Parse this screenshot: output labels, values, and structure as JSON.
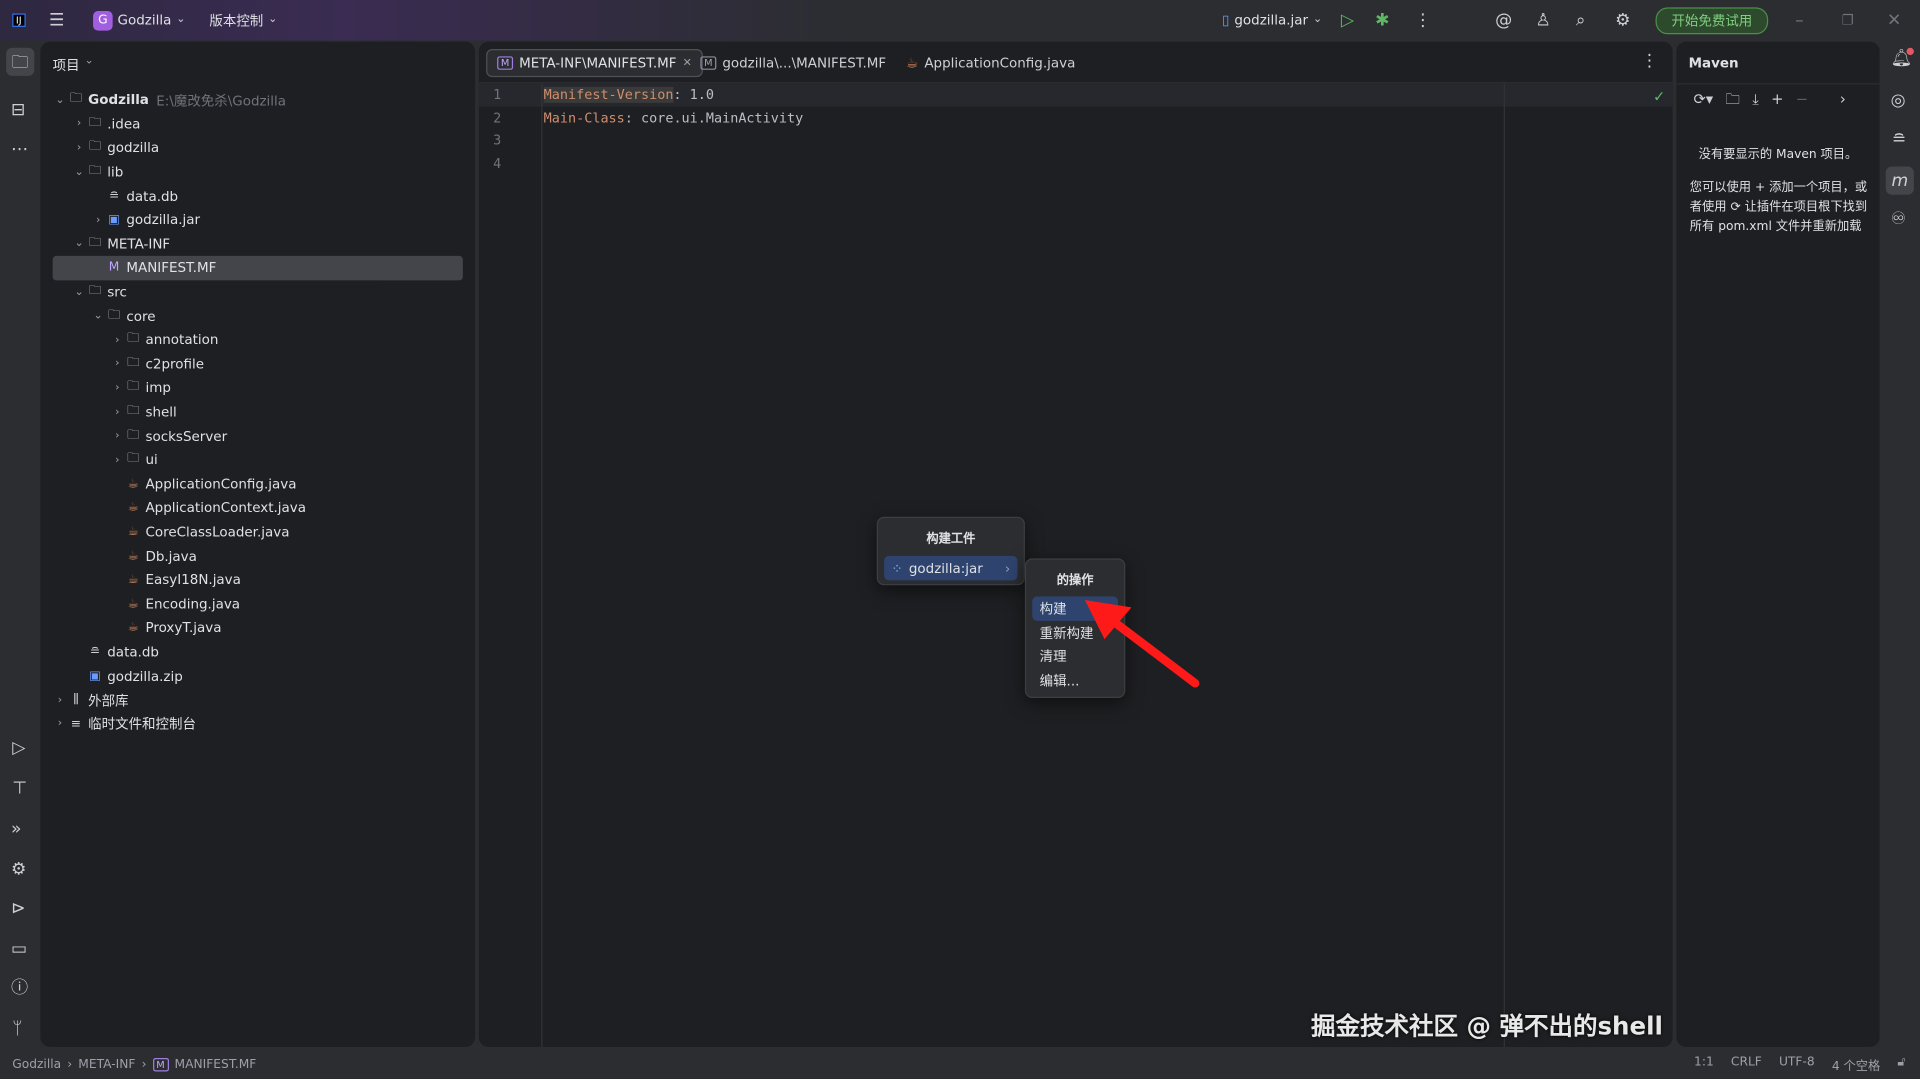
{
  "titlebar": {
    "project_badge": "G",
    "project": "Godzilla",
    "vcs": "版本控制",
    "run_config": "godzilla.jar",
    "trial": "开始免费试用"
  },
  "project_panel": {
    "title": "项目",
    "tree": [
      {
        "label": "Godzilla",
        "hint": "E:\\魔改免杀\\Godzilla",
        "level": 0,
        "chev": "v",
        "icon": "folder-module-icon",
        "bold": true
      },
      {
        "label": ".idea",
        "level": 1,
        "chev": ">",
        "icon": "folder-icon"
      },
      {
        "label": "godzilla",
        "level": 1,
        "chev": ">",
        "icon": "folder-icon"
      },
      {
        "label": "lib",
        "level": 1,
        "chev": "v",
        "icon": "folder-icon"
      },
      {
        "label": "data.db",
        "level": 2,
        "chev": "",
        "icon": "database-icon"
      },
      {
        "label": "godzilla.jar",
        "level": 2,
        "chev": ">",
        "icon": "jar-icon"
      },
      {
        "label": "META-INF",
        "level": 1,
        "chev": "v",
        "icon": "folder-icon"
      },
      {
        "label": "MANIFEST.MF",
        "level": 2,
        "chev": "",
        "icon": "manifest-icon",
        "selected": true
      },
      {
        "label": "src",
        "level": 1,
        "chev": "v",
        "icon": "folder-icon"
      },
      {
        "label": "core",
        "level": 2,
        "chev": "v",
        "icon": "folder-icon"
      },
      {
        "label": "annotation",
        "level": 3,
        "chev": ">",
        "icon": "folder-icon"
      },
      {
        "label": "c2profile",
        "level": 3,
        "chev": ">",
        "icon": "folder-icon"
      },
      {
        "label": "imp",
        "level": 3,
        "chev": ">",
        "icon": "folder-icon"
      },
      {
        "label": "shell",
        "level": 3,
        "chev": ">",
        "icon": "folder-icon"
      },
      {
        "label": "socksServer",
        "level": 3,
        "chev": ">",
        "icon": "folder-icon"
      },
      {
        "label": "ui",
        "level": 3,
        "chev": ">",
        "icon": "folder-icon"
      },
      {
        "label": "ApplicationConfig.java",
        "level": 3,
        "chev": "",
        "icon": "java-icon"
      },
      {
        "label": "ApplicationContext.java",
        "level": 3,
        "chev": "",
        "icon": "java-icon"
      },
      {
        "label": "CoreClassLoader.java",
        "level": 3,
        "chev": "",
        "icon": "java-icon"
      },
      {
        "label": "Db.java",
        "level": 3,
        "chev": "",
        "icon": "java-icon"
      },
      {
        "label": "EasyI18N.java",
        "level": 3,
        "chev": "",
        "icon": "java-icon"
      },
      {
        "label": "Encoding.java",
        "level": 3,
        "chev": "",
        "icon": "java-icon"
      },
      {
        "label": "ProxyT.java",
        "level": 3,
        "chev": "",
        "icon": "java-icon"
      },
      {
        "label": "data.db",
        "level": 1,
        "chev": "",
        "icon": "database-icon"
      },
      {
        "label": "godzilla.zip",
        "level": 1,
        "chev": "",
        "icon": "zip-icon"
      },
      {
        "label": "外部库",
        "level": 0,
        "chev": ">",
        "icon": "library-icon"
      },
      {
        "label": "临时文件和控制台",
        "level": 0,
        "chev": ">",
        "icon": "scratch-icon"
      }
    ]
  },
  "editor": {
    "tabs": [
      {
        "label": "META-INF\\MANIFEST.MF",
        "active": true
      },
      {
        "label": "godzilla\\...\\MANIFEST.MF"
      },
      {
        "label": "ApplicationConfig.java"
      }
    ],
    "lines": [
      {
        "n": "1",
        "key": "Manifest-Version",
        "val": ": 1.0"
      },
      {
        "n": "2",
        "key": "Main-Class",
        "val": ": core.ui.MainActivity"
      },
      {
        "n": "3",
        "key": "",
        "val": ""
      },
      {
        "n": "4",
        "key": "",
        "val": ""
      }
    ]
  },
  "popup": {
    "title": "构建工件",
    "item": "godzilla:jar",
    "sub_title": "的操作",
    "actions": [
      "构建",
      "重新构建",
      "清理",
      "编辑..."
    ]
  },
  "maven": {
    "title": "Maven",
    "empty": "没有要显示的 Maven 项目。",
    "help1": "您可以使用",
    "help2": "添加一个项目，或",
    "help3": "者使用",
    "help4": "让插件在项目根下找到所有 pom.xml 文件并重新加载"
  },
  "watermark": "掘金技术社区 @ 弹不出的shell",
  "status": {
    "crumbs": [
      "Godzilla",
      "META-INF",
      "MANIFEST.MF"
    ],
    "pos": "1:1",
    "eol": "CRLF",
    "enc": "UTF-8",
    "indent": "4 个空格"
  },
  "colors": {
    "accent": "#2e436e",
    "keyword": "#cf8e6d",
    "trial": "#4a8f4a",
    "arrow": "#ff1a1a"
  }
}
